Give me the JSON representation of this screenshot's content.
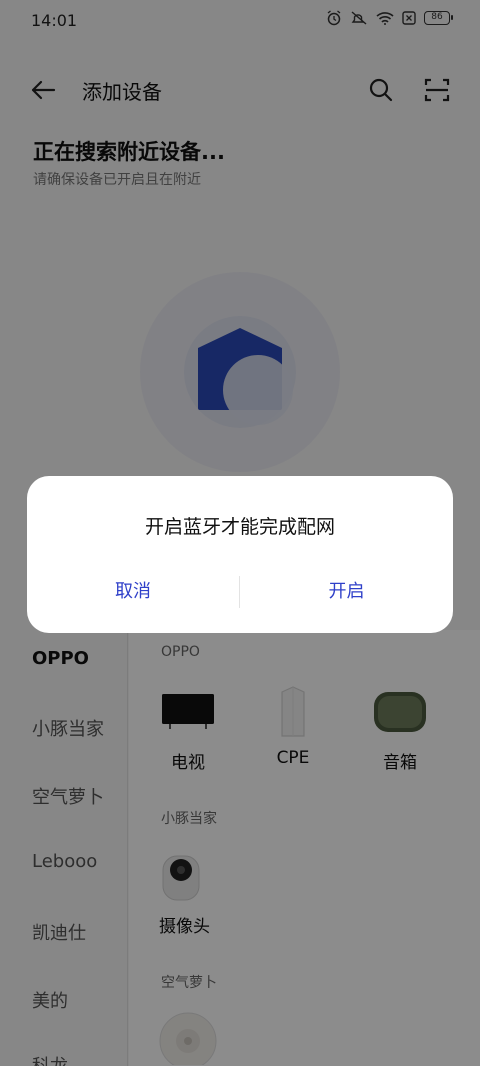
{
  "status_bar": {
    "time": "14:01",
    "battery": "86"
  },
  "header": {
    "title": "添加设备"
  },
  "search": {
    "title": "正在搜索附近设备...",
    "subtitle": "请确保设备已开启且在附近"
  },
  "dialog": {
    "message": "开启蓝牙才能完成配网",
    "cancel_label": "取消",
    "confirm_label": "开启"
  },
  "brands": [
    {
      "label": "OPPO",
      "active": true
    },
    {
      "label": "小豚当家"
    },
    {
      "label": "空气萝卜"
    },
    {
      "label": "Lebooo"
    },
    {
      "label": "凯迪仕"
    },
    {
      "label": "美的"
    },
    {
      "label": "科龙"
    }
  ],
  "device_groups": [
    {
      "title": "OPPO",
      "devices": [
        {
          "label": "电视",
          "icon": "tv-icon"
        },
        {
          "label": "CPE",
          "icon": "cpe-router-icon"
        },
        {
          "label": "音箱",
          "icon": "speaker-icon"
        }
      ]
    },
    {
      "title": "小豚当家",
      "devices": [
        {
          "label": "摄像头",
          "icon": "camera-icon"
        }
      ]
    },
    {
      "title": "空气萝卜",
      "devices": [
        {
          "label": "",
          "icon": "air-purifier-icon"
        }
      ]
    }
  ],
  "colors": {
    "accent": "#2f40c9",
    "overlay": "rgba(0,0,0,0.45)",
    "house_icon": "#2a49b8"
  }
}
